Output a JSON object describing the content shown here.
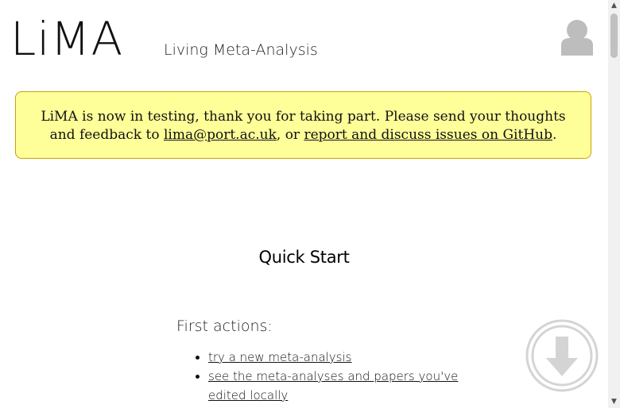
{
  "header": {
    "logo_text": "LiMA",
    "subtitle": "Living Meta-Analysis",
    "user_icon": "user-silhouette-icon"
  },
  "notice": {
    "text_before_email": "LiMA is now in testing, thank you for taking part. Please send your thoughts and feedback to ",
    "email_link": "lima@port.ac.uk",
    "text_between": ", or ",
    "github_link": "report and discuss issues on GitHub",
    "text_after": ".",
    "background_color": "#ffff99",
    "border_color": "#c9a300"
  },
  "main": {
    "quick_start_title": "Quick Start",
    "first_actions_heading": "First actions:",
    "actions": [
      {
        "label": "try a new meta-analysis"
      },
      {
        "label": "see the meta-analyses and papers you've edited locally"
      }
    ]
  },
  "scroll_down_button": {
    "icon": "arrow-down-circle-icon"
  },
  "scrollbar": {
    "up_glyph": "▲",
    "down_glyph": "▼"
  }
}
